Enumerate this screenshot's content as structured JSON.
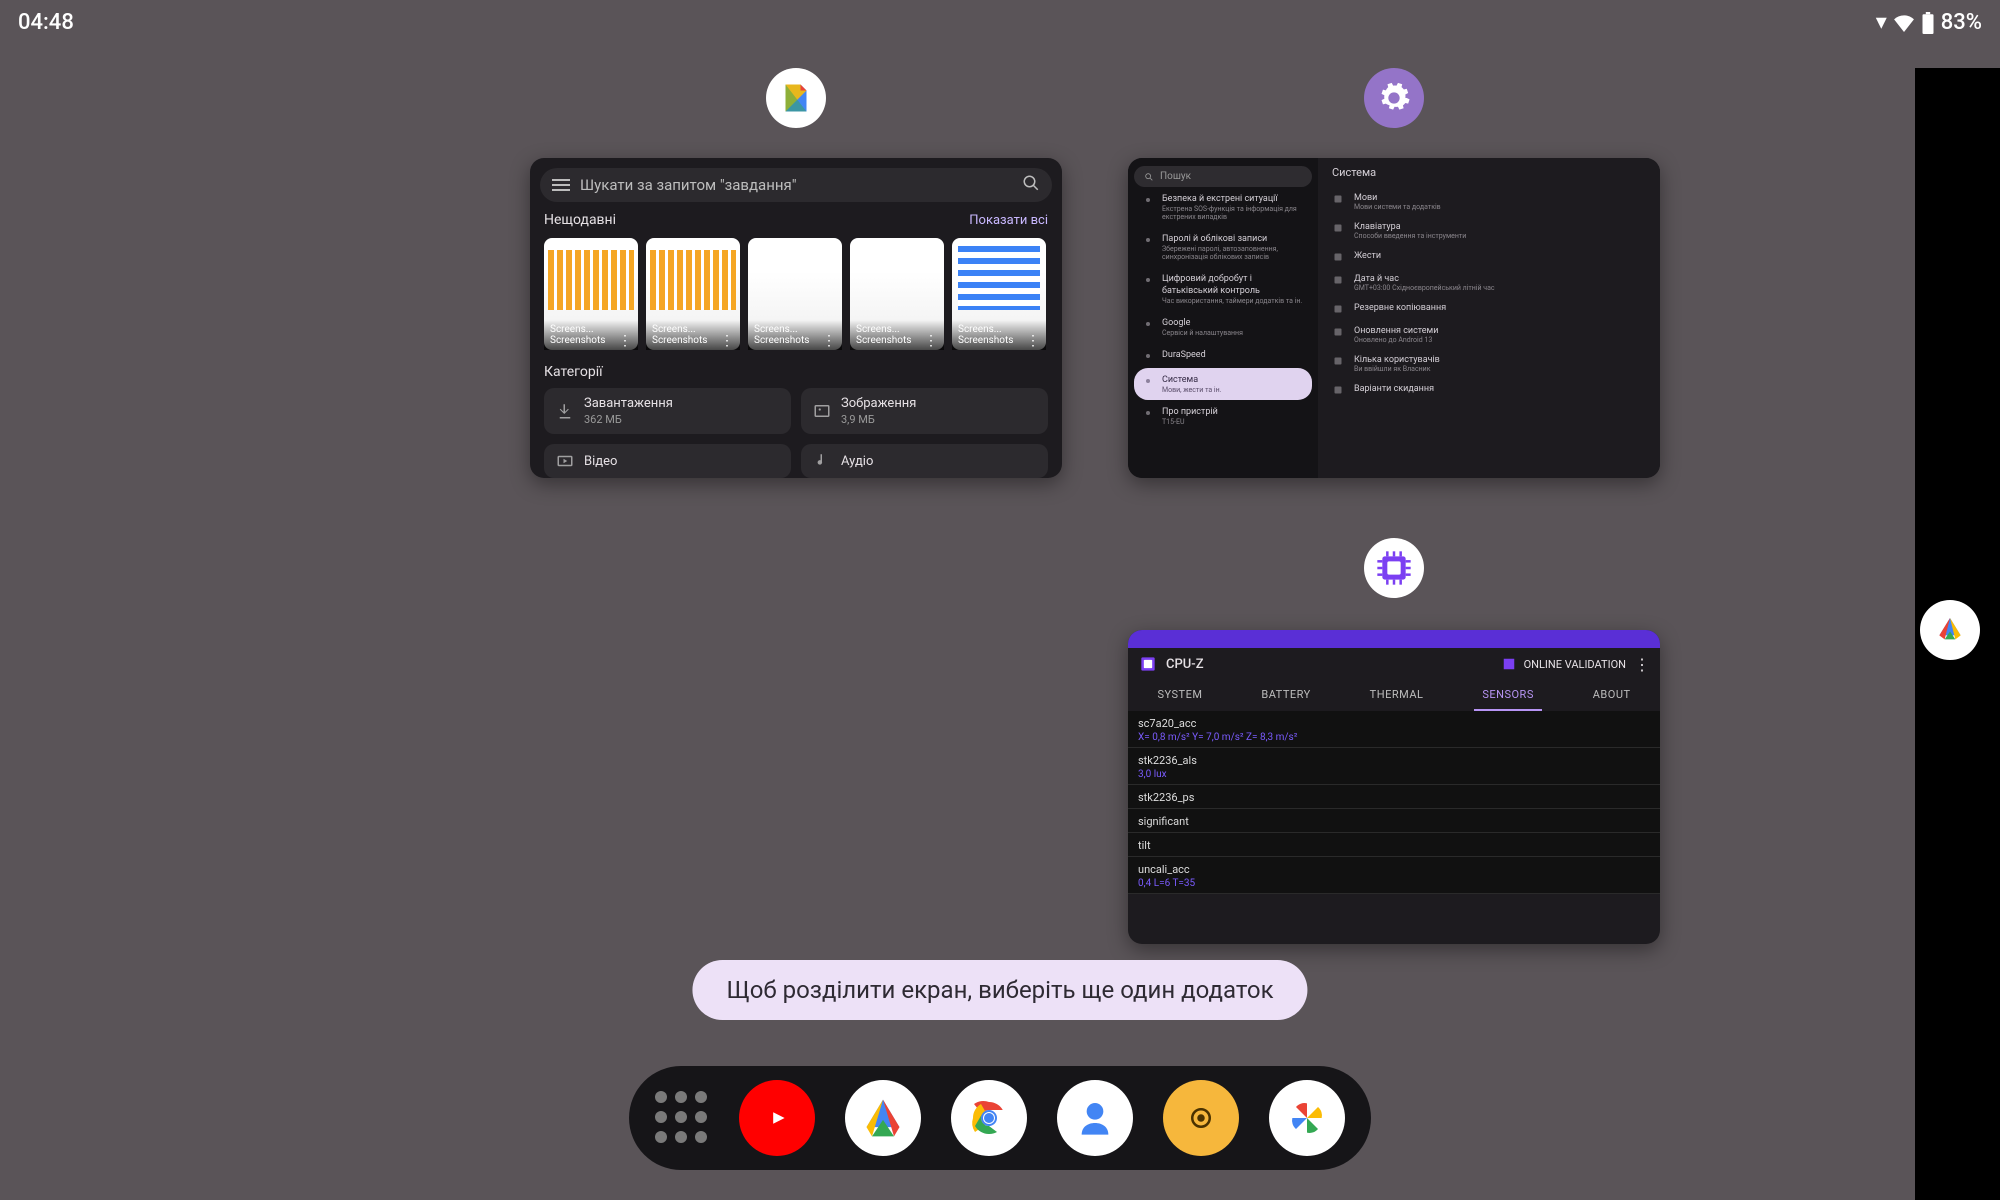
{
  "status": {
    "time": "04:48",
    "battery": "83%"
  },
  "toast": "Щоб розділити екран, виберіть ще один додаток",
  "files": {
    "search_placeholder": "Шукати за запитом \"завдання\"",
    "recent_label": "Нещодавні",
    "show_all": "Показати всі",
    "thumb_label": "Screens...",
    "thumb_sub": "Screenshots",
    "categories_label": "Категорії",
    "cats": [
      {
        "name": "Завантаження",
        "sub": "362 МБ"
      },
      {
        "name": "Зображення",
        "sub": "3,9 МБ"
      },
      {
        "name": "Відео",
        "sub": ""
      },
      {
        "name": "Аудіо",
        "sub": ""
      }
    ]
  },
  "settings": {
    "search": "Пошук",
    "left": [
      {
        "t": "Безпека й екстрені ситуації",
        "s": "Екстрена SOS-функція та інформація для екстрених випадків"
      },
      {
        "t": "Паролі й облікові записи",
        "s": "Збережені паролі, автозаповнення, синхронізація облікових записів"
      },
      {
        "t": "Цифровий добробут і батьківський контроль",
        "s": "Час використання, таймери додатків та ін."
      },
      {
        "t": "Google",
        "s": "Сервіси й налаштування"
      },
      {
        "t": "DuraSpeed",
        "s": ""
      },
      {
        "t": "Система",
        "s": "Мови, жести та ін."
      },
      {
        "t": "Про пристрій",
        "s": "T15-EU"
      }
    ],
    "left_selected": 5,
    "right_title": "Система",
    "right": [
      {
        "t": "Мови",
        "s": "Мови системи та додатків"
      },
      {
        "t": "Клавіатура",
        "s": "Способи введення та інструменти"
      },
      {
        "t": "Жести",
        "s": ""
      },
      {
        "t": "Дата й час",
        "s": "GMT+03:00 Східноєвропейський літній час"
      },
      {
        "t": "Резервне копіювання",
        "s": ""
      },
      {
        "t": "Оновлення системи",
        "s": "Оновлено до Android 13"
      },
      {
        "t": "Кілька користувачів",
        "s": "Ви ввійшли як Власник"
      },
      {
        "t": "Варіанти скидання",
        "s": ""
      }
    ]
  },
  "cpuz": {
    "title": "CPU-Z",
    "validate": "ONLINE VALIDATION",
    "tabs": [
      "SYSTEM",
      "BATTERY",
      "THERMAL",
      "SENSORS",
      "ABOUT"
    ],
    "active_tab": 3,
    "rows": [
      {
        "n": "sc7a20_acc",
        "v": "X= 0,8 m/s²   Y= 7,0 m/s²   Z= 8,3 m/s²"
      },
      {
        "n": "stk2236_als",
        "v": "3,0 lux"
      },
      {
        "n": "stk2236_ps",
        "v": ""
      },
      {
        "n": "significant",
        "v": ""
      },
      {
        "n": "tilt",
        "v": ""
      },
      {
        "n": "uncali_acc",
        "v": "0,4 L=6 T=35"
      }
    ]
  },
  "dock": {
    "apps": [
      "youtube",
      "browser",
      "chrome",
      "contacts",
      "app5",
      "photos"
    ]
  }
}
